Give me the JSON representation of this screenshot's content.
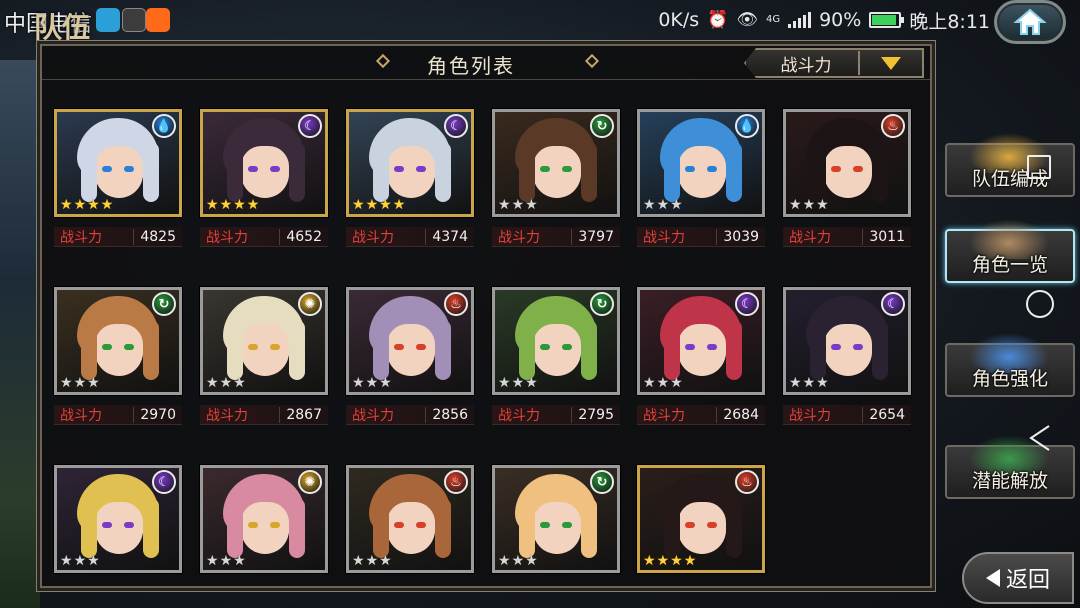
{
  "statusbar": {
    "carrier": "中国电信",
    "screen_title": "队伍",
    "speed": "0K/s",
    "net": "4G",
    "battery": "90%",
    "battery_level": 0.9,
    "time": "晚上8:11"
  },
  "panel": {
    "title": "角色列表",
    "sort_label": "战斗力"
  },
  "power_label": "战斗力",
  "cards": [
    {
      "element": "water",
      "stars": 4,
      "gold": true,
      "power": "4825"
    },
    {
      "element": "dark",
      "stars": 4,
      "gold": true,
      "power": "4652"
    },
    {
      "element": "dark",
      "stars": 4,
      "gold": true,
      "power": "4374"
    },
    {
      "element": "wind",
      "stars": 3,
      "gold": false,
      "power": "3797"
    },
    {
      "element": "water",
      "stars": 3,
      "gold": false,
      "power": "3039"
    },
    {
      "element": "fire",
      "stars": 3,
      "gold": false,
      "power": "3011"
    },
    {
      "element": "wind",
      "stars": 3,
      "gold": false,
      "power": "2970"
    },
    {
      "element": "light",
      "stars": 3,
      "gold": false,
      "power": "2867"
    },
    {
      "element": "fire",
      "stars": 3,
      "gold": false,
      "power": "2856"
    },
    {
      "element": "wind",
      "stars": 3,
      "gold": false,
      "power": "2795"
    },
    {
      "element": "dark",
      "stars": 3,
      "gold": false,
      "power": "2684"
    },
    {
      "element": "dark",
      "stars": 3,
      "gold": false,
      "power": "2654"
    },
    {
      "element": "dark",
      "stars": 3,
      "gold": false,
      "power": ""
    },
    {
      "element": "light",
      "stars": 3,
      "gold": false,
      "power": ""
    },
    {
      "element": "fire",
      "stars": 3,
      "gold": false,
      "power": ""
    },
    {
      "element": "wind",
      "stars": 3,
      "gold": false,
      "power": ""
    },
    {
      "element": "fire",
      "stars": 4,
      "gold": true,
      "power": ""
    }
  ],
  "side_menu": [
    {
      "label": "队伍编成",
      "active": false
    },
    {
      "label": "角色一览",
      "active": true
    },
    {
      "label": "角色强化",
      "active": false
    },
    {
      "label": "潜能解放",
      "active": false
    }
  ],
  "back_label": "返回",
  "colors": {
    "water": "#2a7fd8",
    "dark": "#7a3bc8",
    "wind": "#2a9a3a",
    "fire": "#d8402a",
    "light": "#d8a62a",
    "power_label": "#e2413a",
    "active_glow": "#62c9ea"
  }
}
